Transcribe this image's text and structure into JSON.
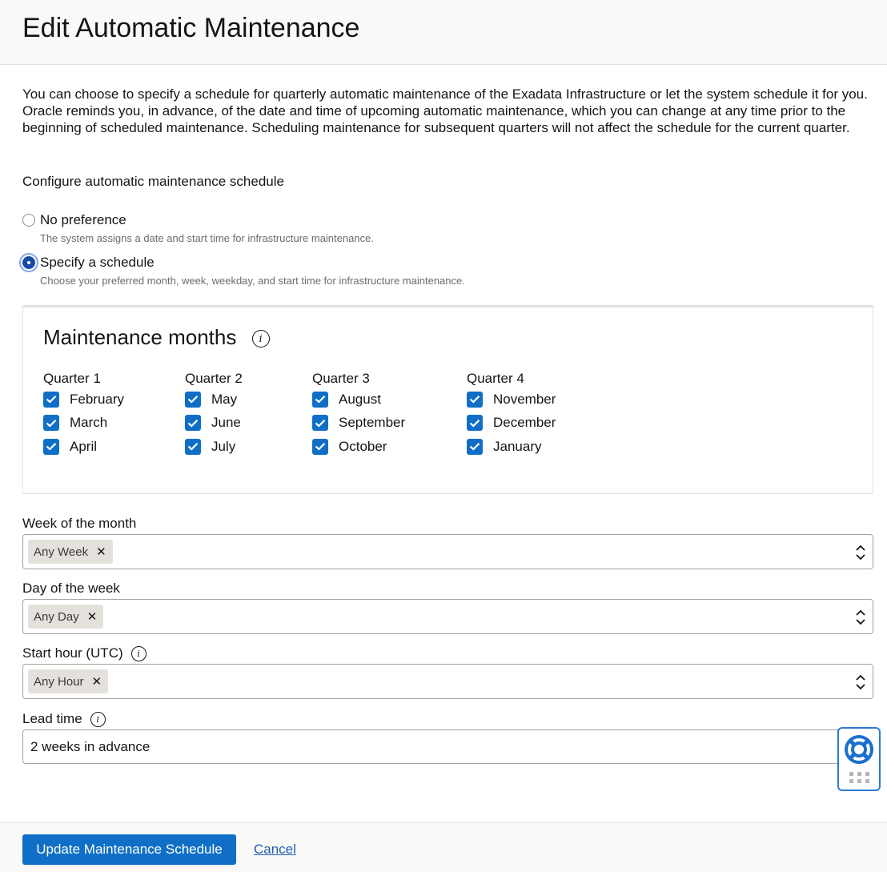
{
  "header": {
    "title": "Edit Automatic Maintenance"
  },
  "description": "You can choose to specify a schedule for quarterly automatic maintenance of the Exadata Infrastructure or let the system schedule it for you. Oracle reminds you, in advance, of the date and time of upcoming automatic maintenance, which you can change at any time prior to the beginning of scheduled maintenance. Scheduling maintenance for subsequent quarters will not affect the schedule for the current quarter.",
  "schedule": {
    "label": "Configure automatic maintenance schedule",
    "options": [
      {
        "label": "No preference",
        "help": "The system assigns a date and start time for infrastructure maintenance.",
        "checked": false
      },
      {
        "label": "Specify a schedule",
        "help": "Choose your preferred month, week, weekday, and start time for infrastructure maintenance.",
        "checked": true
      }
    ]
  },
  "months_card": {
    "title": "Maintenance months",
    "info_icon": "info-icon",
    "quarters": [
      {
        "title": "Quarter 1",
        "months": [
          "February",
          "March",
          "April"
        ]
      },
      {
        "title": "Quarter 2",
        "months": [
          "May",
          "June",
          "July"
        ]
      },
      {
        "title": "Quarter 3",
        "months": [
          "August",
          "September",
          "October"
        ]
      },
      {
        "title": "Quarter 4",
        "months": [
          "November",
          "December",
          "January"
        ]
      }
    ],
    "all_checked": true
  },
  "fields": {
    "week": {
      "label": "Week of the month",
      "chip": "Any Week"
    },
    "day": {
      "label": "Day of the week",
      "chip": "Any Day"
    },
    "hour": {
      "label": "Start hour (UTC)",
      "chip": "Any Hour"
    },
    "lead": {
      "label": "Lead time",
      "value": "2 weeks in advance"
    }
  },
  "footer": {
    "primary_label": "Update Maintenance Schedule",
    "cancel_label": "Cancel"
  },
  "colors": {
    "accent": "#0f6fc6",
    "radio_selected": "#1a4aa8",
    "help_widget_border": "#2e78d2"
  }
}
